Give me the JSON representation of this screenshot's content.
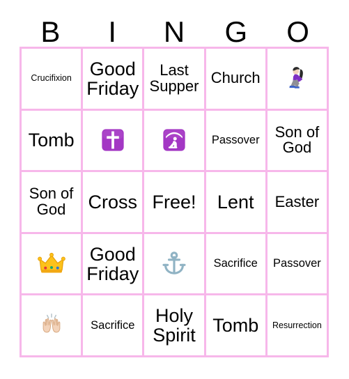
{
  "card": {
    "header_letters": [
      "B",
      "I",
      "N",
      "G",
      "O"
    ],
    "border_color": "#f7b7ea",
    "background_color": "#ffffff",
    "text_color": "#000000",
    "free_space": "Free!",
    "rows": 5,
    "columns": 5
  },
  "grid": [
    [
      {
        "text": "Crucifixion",
        "size": "xs",
        "type": "text"
      },
      {
        "text": "Good Friday",
        "size": "lg",
        "type": "text"
      },
      {
        "text": "Last Supper",
        "size": "md",
        "type": "text"
      },
      {
        "text": "Church",
        "size": "md",
        "type": "text"
      },
      {
        "text": "",
        "size": "md",
        "type": "emoji",
        "emoji": "kneeling-woman",
        "emoji_char": "🧎‍♀️"
      }
    ],
    [
      {
        "text": "Tomb",
        "size": "lg",
        "type": "text"
      },
      {
        "text": "",
        "size": "md",
        "type": "emoji",
        "emoji": "latin-cross",
        "emoji_char": "✝️"
      },
      {
        "text": "",
        "size": "md",
        "type": "emoji",
        "emoji": "place-of-worship",
        "emoji_char": "🛐"
      },
      {
        "text": "Passover",
        "size": "sm",
        "type": "text"
      },
      {
        "text": "Son of God",
        "size": "md",
        "type": "text"
      }
    ],
    [
      {
        "text": "Son of God",
        "size": "md",
        "type": "text"
      },
      {
        "text": "Cross",
        "size": "lg",
        "type": "text"
      },
      {
        "text": "Free!",
        "size": "lg",
        "type": "text"
      },
      {
        "text": "Lent",
        "size": "lg",
        "type": "text"
      },
      {
        "text": "Easter",
        "size": "md",
        "type": "text"
      }
    ],
    [
      {
        "text": "",
        "size": "md",
        "type": "emoji",
        "emoji": "crown",
        "emoji_char": "👑"
      },
      {
        "text": "Good Friday",
        "size": "lg",
        "type": "text"
      },
      {
        "text": "",
        "size": "md",
        "type": "emoji",
        "emoji": "anchor",
        "emoji_char": "⚓"
      },
      {
        "text": "Sacrifice",
        "size": "sm",
        "type": "text"
      },
      {
        "text": "Passover",
        "size": "sm",
        "type": "text"
      }
    ],
    [
      {
        "text": "",
        "size": "md",
        "type": "emoji",
        "emoji": "raising-hands",
        "emoji_char": "🙌"
      },
      {
        "text": "Sacrifice",
        "size": "sm",
        "type": "text"
      },
      {
        "text": "Holy Spirit",
        "size": "lg",
        "type": "text"
      },
      {
        "text": "Tomb",
        "size": "lg",
        "type": "text"
      },
      {
        "text": "Resurrection",
        "size": "xs",
        "type": "text"
      }
    ]
  ]
}
